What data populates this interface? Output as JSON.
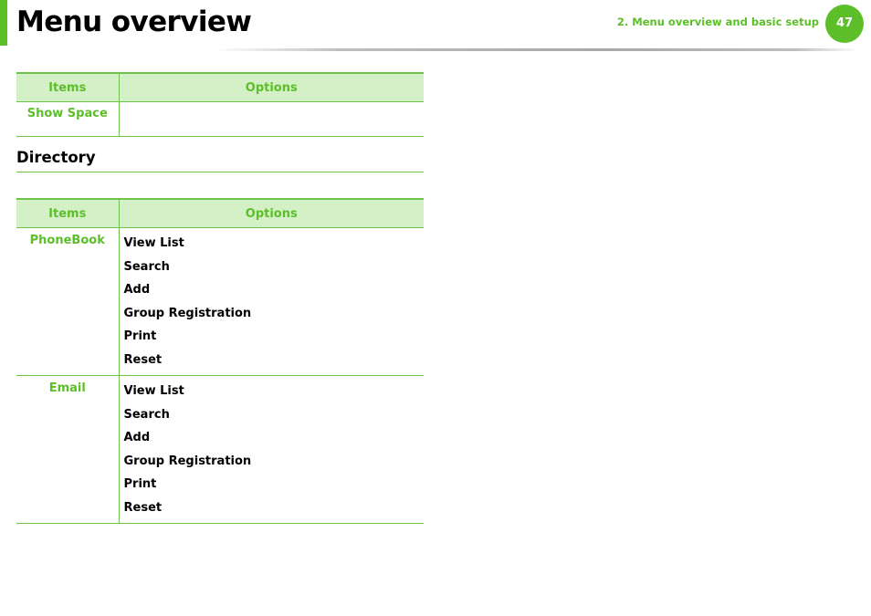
{
  "header": {
    "title": "Menu overview",
    "chapter": "2.  Menu overview and basic setup",
    "page_number": "47",
    "accent_color": "#5cbf2a"
  },
  "table1": {
    "headers": {
      "items": "Items",
      "options": "Options"
    },
    "rows": [
      {
        "item": "Show Space",
        "options": []
      }
    ]
  },
  "section": {
    "heading": "Directory"
  },
  "table2": {
    "headers": {
      "items": "Items",
      "options": "Options"
    },
    "rows": [
      {
        "item": "PhoneBook",
        "options": [
          "View List",
          "Search",
          "Add",
          "Group Registration",
          "Print",
          "Reset"
        ]
      },
      {
        "item": "Email",
        "options": [
          "View List",
          "Search",
          "Add",
          "Group Registration",
          "Print",
          "Reset"
        ]
      }
    ]
  }
}
